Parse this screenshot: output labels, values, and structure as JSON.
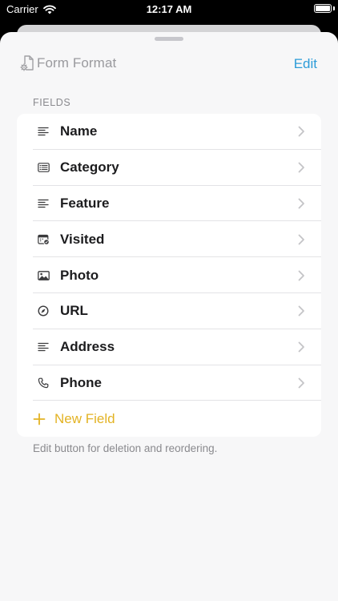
{
  "status_bar": {
    "carrier": "Carrier",
    "time": "12:17 AM",
    "battery_level": 1.0
  },
  "header": {
    "title": "Form Format",
    "title_icon": "document-gear-icon",
    "edit_label": "Edit"
  },
  "fields_section": {
    "label": "FIELDS",
    "items": [
      {
        "label": "Name",
        "icon": "text-lines-icon"
      },
      {
        "label": "Category",
        "icon": "list-box-icon"
      },
      {
        "label": "Feature",
        "icon": "text-lines-icon"
      },
      {
        "label": "Visited",
        "icon": "calendar-check-icon"
      },
      {
        "label": "Photo",
        "icon": "photo-icon"
      },
      {
        "label": "URL",
        "icon": "compass-icon"
      },
      {
        "label": "Address",
        "icon": "text-lines-icon"
      },
      {
        "label": "Phone",
        "icon": "phone-icon"
      }
    ],
    "new_field_label": "New Field"
  },
  "footer_note": "Edit button for deletion and reordering.",
  "colors": {
    "accent_edit": "#2d9cd8",
    "accent_new_field": "#e3b324",
    "sheet_background": "#f7f7f8",
    "card_background": "#ffffff",
    "secondary_text": "#8a8a8e"
  }
}
